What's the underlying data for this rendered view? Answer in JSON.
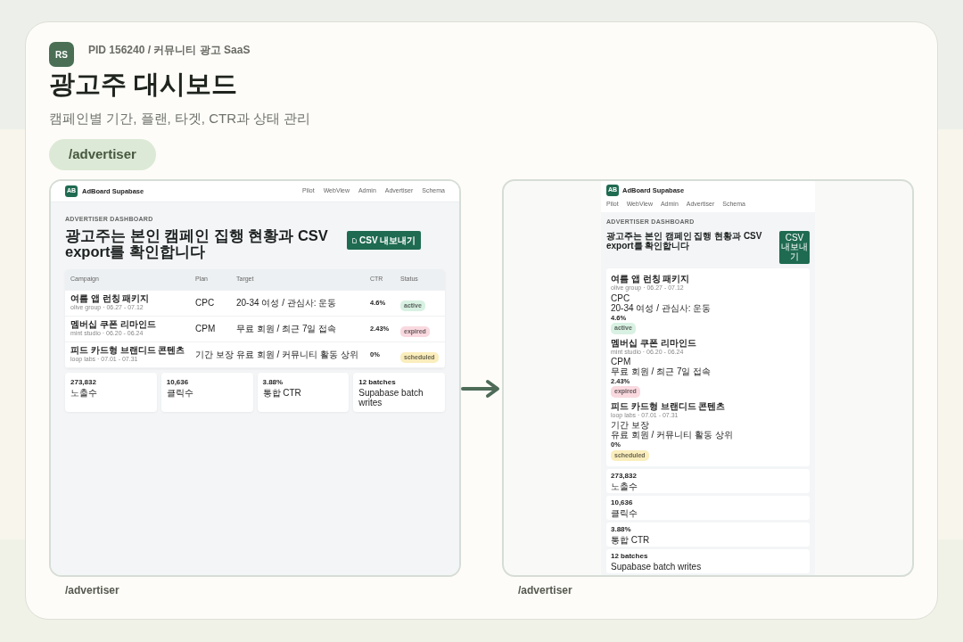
{
  "header": {
    "avatar": "RS",
    "pid": "PID 156240 / 커뮤니티 광고 SaaS",
    "title": "광고주 대시보드",
    "subtitle": "캠페인별 기간, 플랜, 타겟, CTR과 상태 관리",
    "route": "/advertiser"
  },
  "screens": [
    {
      "kind": "desktop",
      "caption": "/advertiser",
      "app": {
        "logo": "AB",
        "brand": "AdBoard Supabase",
        "nav": [
          "Pilot",
          "WebView",
          "Admin",
          "Advertiser",
          "Schema"
        ],
        "eyebrow": "ADVERTISER DASHBOARD",
        "heading": "광고주는 본인 캠페인 집행 현황과 CSV export를 확인합니다",
        "export_button": "CSV 내보내기",
        "columns": [
          "Campaign",
          "Plan",
          "Target",
          "CTR",
          "Status"
        ],
        "campaigns": [
          {
            "name": "여름 앱 런칭 패키지",
            "meta": "olive group · 06.27 - 07.12",
            "plan": "CPC",
            "target": "20-34 여성 / 관심사: 운동",
            "ctr": "4.6%",
            "status": "active",
            "color": "#d8f1e2"
          },
          {
            "name": "멤버십 쿠폰 리마인드",
            "meta": "mint studio · 06.20 - 06.24",
            "plan": "CPM",
            "target": "무료 회원 / 최근 7일 접속",
            "ctr": "2.43%",
            "status": "expired",
            "color": "#f9d9df"
          },
          {
            "name": "피드 카드형 브랜디드 콘텐츠",
            "meta": "loop labs · 07.01 - 07.31",
            "plan": "기간 보장",
            "target": "유료 회원 / 커뮤니티 활동 상위",
            "ctr": "0%",
            "status": "scheduled",
            "color": "#fbeebd"
          }
        ],
        "stats": [
          {
            "value": "273,832",
            "label": "노출수"
          },
          {
            "value": "10,636",
            "label": "클릭수"
          },
          {
            "value": "3.88%",
            "label": "통합 CTR"
          },
          {
            "value": "12 batches",
            "label": "Supabase batch writes"
          }
        ]
      }
    },
    {
      "kind": "mobile",
      "caption": "/advertiser",
      "app": {
        "logo": "AB",
        "brand": "AdBoard Supabase",
        "nav": [
          "Pilot",
          "WebView",
          "Admin",
          "Advertiser",
          "Schema"
        ],
        "eyebrow": "ADVERTISER DASHBOARD",
        "heading": "광고주는 본인 캠페인 집행 현황과 CSV export를 확인합니다",
        "export_button": "CSV 내보내기",
        "campaigns": [
          {
            "name": "여름 앱 런칭 패키지",
            "meta": "olive group · 06.27 - 07.12",
            "plan": "CPC",
            "target": "20-34 여성 / 관심사: 운동",
            "ctr": "4.6%",
            "status": "active",
            "color": "#d8f1e2"
          },
          {
            "name": "멤버십 쿠폰 리마인드",
            "meta": "mint studio · 06.20 - 06.24",
            "plan": "CPM",
            "target": "무료 회원 / 최근 7일 접속",
            "ctr": "2.43%",
            "status": "expired",
            "color": "#f9d9df"
          },
          {
            "name": "피드 카드형 브랜디드 콘텐츠",
            "meta": "loop labs · 07.01 - 07.31",
            "plan": "기간 보장",
            "target": "유료 회원 / 커뮤니티 활동 상위",
            "ctr": "0%",
            "status": "scheduled",
            "color": "#fbeebd"
          }
        ],
        "stats": [
          {
            "value": "273,832",
            "label": "노출수"
          },
          {
            "value": "10,636",
            "label": "클릭수"
          },
          {
            "value": "3.88%",
            "label": "통합 CTR"
          },
          {
            "value": "12 batches",
            "label": "Supabase batch writes"
          }
        ]
      }
    }
  ]
}
